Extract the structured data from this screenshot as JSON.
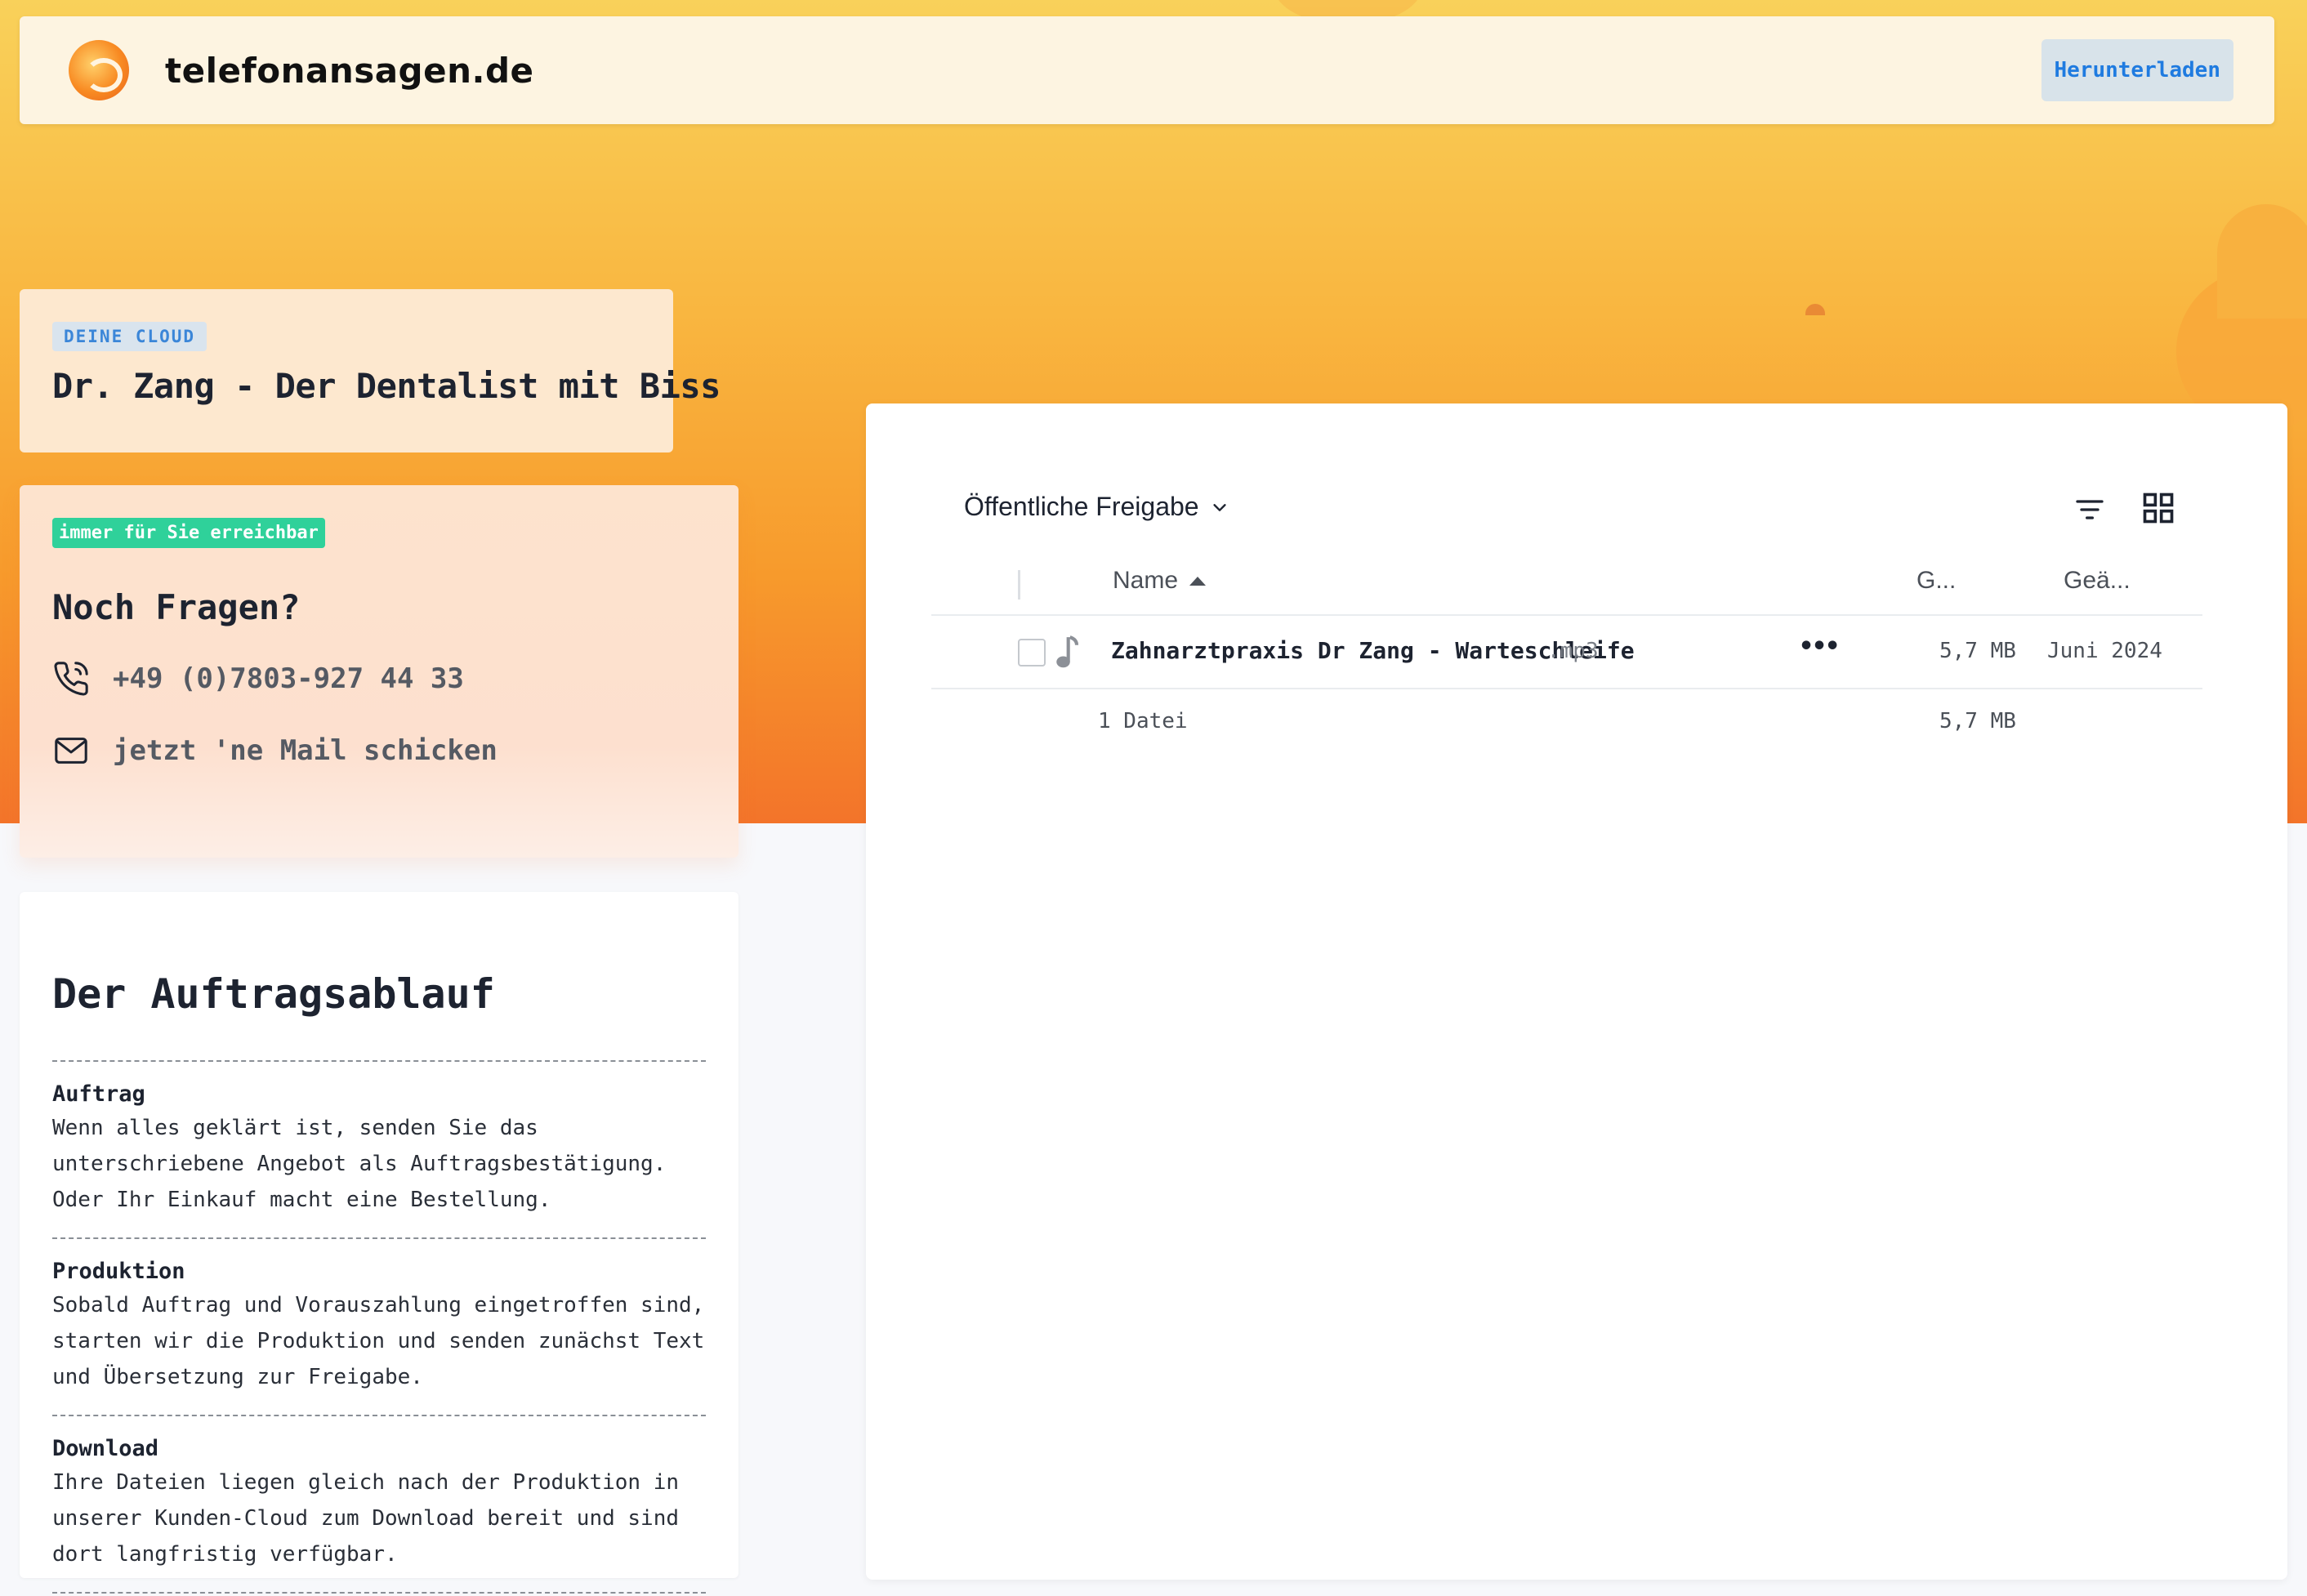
{
  "header": {
    "brand": "telefonansagen.de",
    "download_label": "Herunterladen"
  },
  "cloud_card": {
    "tag": "DEINE CLOUD",
    "title": "Dr. Zang - Der Dentalist mit Biss"
  },
  "contact_card": {
    "tag": "immer für Sie erreichbar",
    "title": "Noch Fragen?",
    "phone": "+49 (0)7803-927 44 33",
    "mail": "jetzt 'ne Mail schicken"
  },
  "process_card": {
    "title": "Der Auftragsablauf",
    "steps": [
      {
        "title": "Auftrag",
        "text": "Wenn alles geklärt ist, senden Sie das unterschriebene Angebot als Auftragsbestätigung. Oder Ihr Einkauf macht eine Bestellung."
      },
      {
        "title": "Produktion",
        "text": "Sobald Auftrag und Vorauszahlung eingetroffen sind, starten wir die Produktion und senden zunächst Text und Übersetzung zur Freigabe."
      },
      {
        "title": "Download",
        "text": "Ihre Dateien liegen gleich nach der Produktion in unserer Kunden-Cloud zum Download bereit und sind dort langfristig verfügbar."
      }
    ]
  },
  "files": {
    "share_label": "Öffentliche Freigabe",
    "columns": {
      "name": "Name",
      "size": "G...",
      "changed": "Geä..."
    },
    "rows": [
      {
        "name": "Zahnarztpraxis Dr Zang - Warteschleife",
        "ext": ".mp3",
        "actions": "•••",
        "size": "5,7 MB",
        "date": "Juni 2024"
      }
    ],
    "summary": {
      "count": "1 Datei",
      "total": "5,7 MB"
    }
  },
  "colors": {
    "accent_orange": "#f79a2c",
    "link_blue": "#1f7be0",
    "badge_green": "#2fd19a"
  },
  "icons": {
    "phone": "phone-icon",
    "mail": "mail-icon",
    "filter": "filter-icon",
    "grid": "grid-view-icon",
    "music": "music-note-icon"
  }
}
